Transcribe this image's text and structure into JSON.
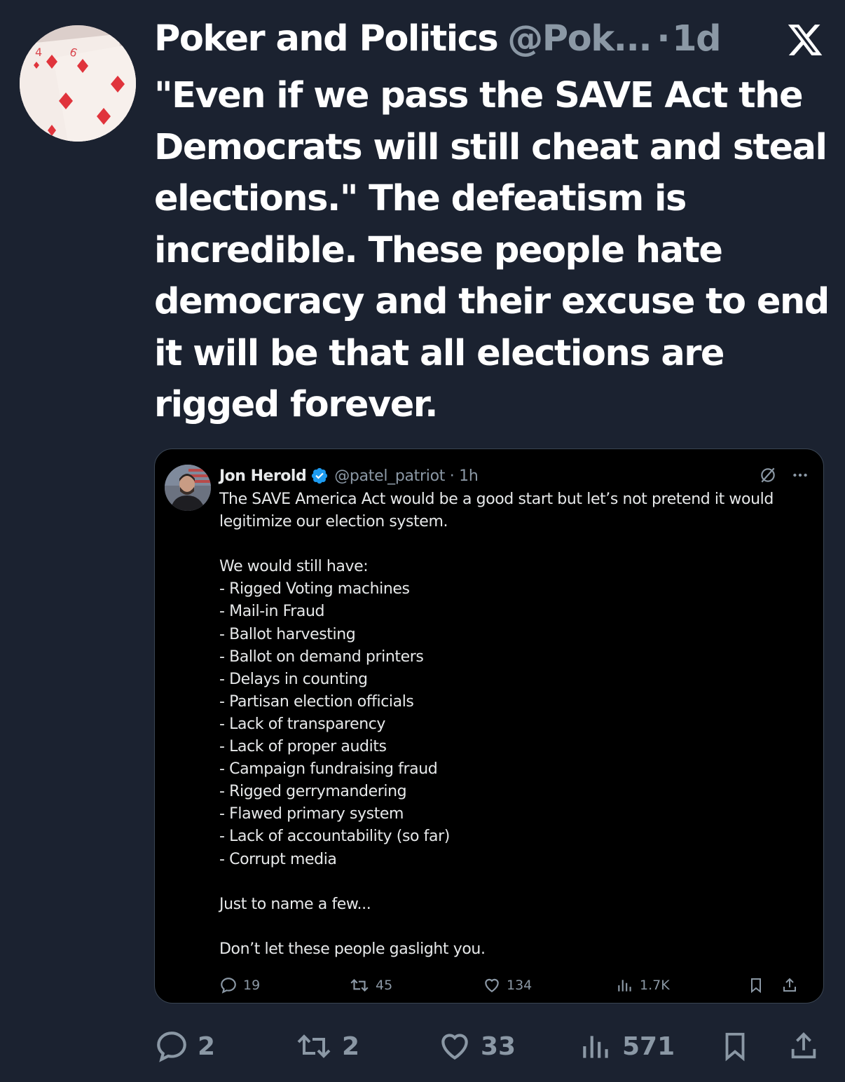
{
  "tweet": {
    "author_name": "Poker and Politics",
    "author_handle": "@Pok...",
    "separator": "·",
    "time": "1d",
    "text_lines": [
      "\"Even if we pass the SAVE Act the",
      "Democrats will still cheat and steal",
      "elections.\" The defeatism is",
      "incredible. These people hate",
      "democracy and their excuse to end",
      "it will be that all elections are",
      "rigged forever."
    ],
    "replies": "2",
    "reposts": "2",
    "likes": "33",
    "views": "571"
  },
  "quoted": {
    "author_name": "Jon Herold",
    "author_handle": "@patel_patriot · 1h",
    "body_lines": [
      "The SAVE America Act would be a good start but let’s not pretend it would",
      "legitimize our election system.",
      "",
      "We would still have:",
      "- Rigged Voting machines",
      "- Mail-in Fraud",
      "- Ballot harvesting",
      "- Ballot on demand printers",
      "- Delays in counting",
      "- Partisan election officials",
      "- Lack of transparency",
      "- Lack of proper audits",
      "- Campaign fundraising fraud",
      "- Rigged gerrymandering",
      "- Flawed primary system",
      "- Lack of accountability (so far)",
      "- Corrupt media",
      "",
      "Just to name a few...",
      "",
      "Don’t let these people gaslight you."
    ],
    "replies": "19",
    "reposts": "45",
    "likes": "134",
    "views": "1.7K"
  },
  "icons": {
    "logo": "x-logo-icon",
    "verified": "verified-badge-icon",
    "reply": "reply-icon",
    "repost": "repost-icon",
    "like": "heart-icon",
    "views": "views-chart-icon",
    "bookmark": "bookmark-icon",
    "share": "share-icon",
    "grok": "grok-icon",
    "more": "more-icon"
  },
  "colors": {
    "background": "#1b2230",
    "quote_background": "#000000",
    "muted_text": "#8b98a5",
    "verified_blue": "#1d9bf0",
    "card_suit_red": "#e0343c"
  }
}
